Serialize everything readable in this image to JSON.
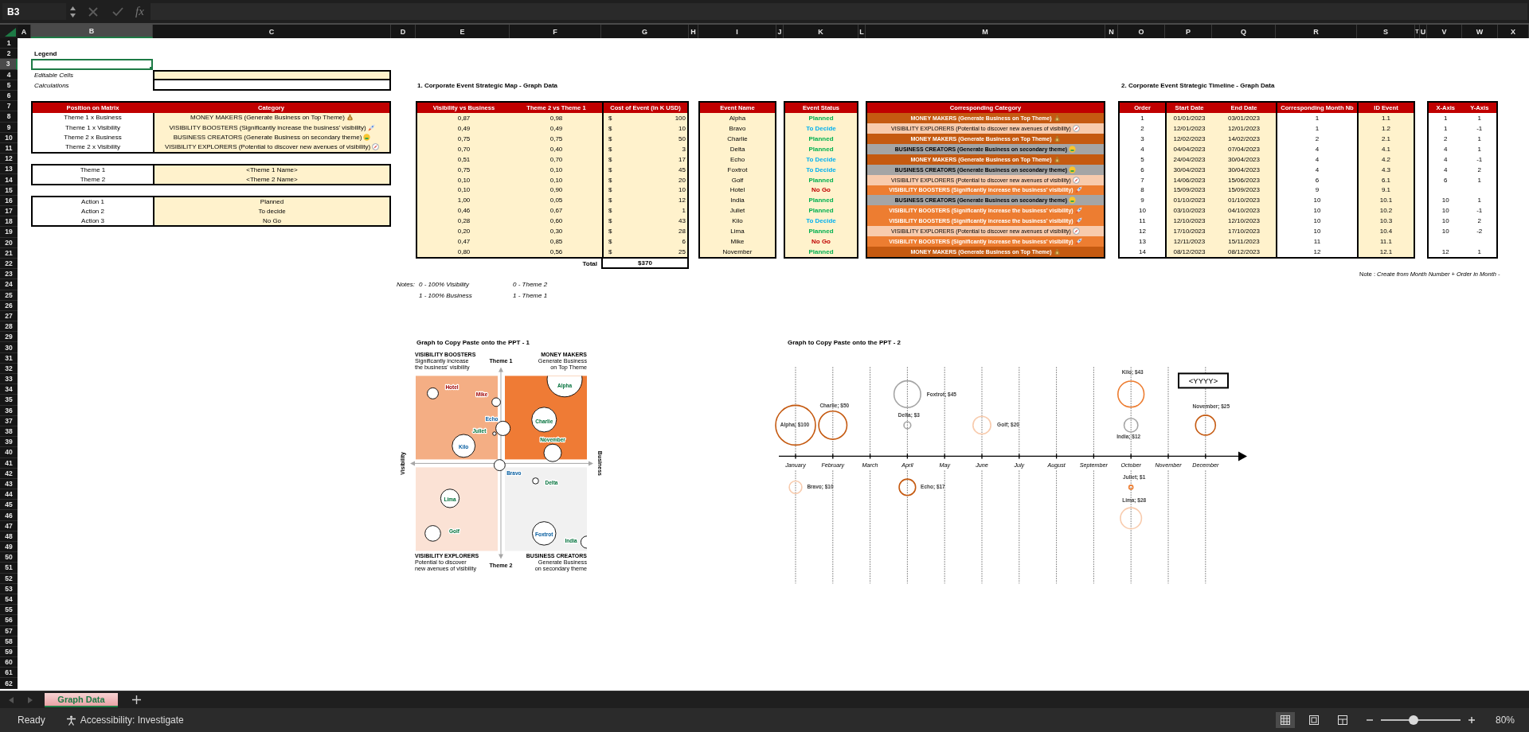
{
  "formula_bar": {
    "name_box": "B3",
    "function_label": "fx"
  },
  "column_headers": [
    {
      "label": "A",
      "selected": false
    },
    {
      "label": "B",
      "selected": true
    },
    {
      "label": "C",
      "selected": false
    },
    {
      "label": "D",
      "selected": false
    },
    {
      "label": "E",
      "selected": false
    },
    {
      "label": "F",
      "selected": false
    },
    {
      "label": "G",
      "selected": false
    },
    {
      "label": "H",
      "selected": false
    },
    {
      "label": "I",
      "selected": false
    },
    {
      "label": "J",
      "selected": false
    },
    {
      "label": "K",
      "selected": false
    },
    {
      "label": "L",
      "selected": false
    },
    {
      "label": "M",
      "selected": false
    },
    {
      "label": "N",
      "selected": false
    },
    {
      "label": "O",
      "selected": false
    },
    {
      "label": "P",
      "selected": false
    },
    {
      "label": "Q",
      "selected": false
    },
    {
      "label": "R",
      "selected": false
    },
    {
      "label": "S",
      "selected": false
    },
    {
      "label": "T",
      "selected": false
    },
    {
      "label": "U",
      "selected": false
    },
    {
      "label": "V",
      "selected": false
    },
    {
      "label": "W",
      "selected": false
    },
    {
      "label": "X",
      "selected": false
    }
  ],
  "row_headers": [
    {
      "label": "1",
      "selected": false
    },
    {
      "label": "2",
      "selected": false
    },
    {
      "label": "3",
      "selected": true
    },
    {
      "label": "4",
      "selected": false
    },
    {
      "label": "5",
      "selected": false
    },
    {
      "label": "6",
      "selected": false
    },
    {
      "label": "7",
      "selected": false
    },
    {
      "label": "8",
      "selected": false
    },
    {
      "label": "9",
      "selected": false
    },
    {
      "label": "10",
      "selected": false
    },
    {
      "label": "11",
      "selected": false
    },
    {
      "label": "12",
      "selected": false
    },
    {
      "label": "13",
      "selected": false
    },
    {
      "label": "14",
      "selected": false
    },
    {
      "label": "15",
      "selected": false
    },
    {
      "label": "16",
      "selected": false
    },
    {
      "label": "17",
      "selected": false
    },
    {
      "label": "18",
      "selected": false
    },
    {
      "label": "19",
      "selected": false
    },
    {
      "label": "20",
      "selected": false
    },
    {
      "label": "21",
      "selected": false
    },
    {
      "label": "22",
      "selected": false
    },
    {
      "label": "23",
      "selected": false
    },
    {
      "label": "24",
      "selected": false
    },
    {
      "label": "25",
      "selected": false
    },
    {
      "label": "26",
      "selected": false
    },
    {
      "label": "27",
      "selected": false
    },
    {
      "label": "28",
      "selected": false
    },
    {
      "label": "29",
      "selected": false
    },
    {
      "label": "30",
      "selected": false
    },
    {
      "label": "31",
      "selected": false
    },
    {
      "label": "32",
      "selected": false
    },
    {
      "label": "33",
      "selected": false
    },
    {
      "label": "34",
      "selected": false
    },
    {
      "label": "35",
      "selected": false
    },
    {
      "label": "36",
      "selected": false
    },
    {
      "label": "37",
      "selected": false
    },
    {
      "label": "38",
      "selected": false
    },
    {
      "label": "39",
      "selected": false
    },
    {
      "label": "40",
      "selected": false
    },
    {
      "label": "41",
      "selected": false
    },
    {
      "label": "42",
      "selected": false
    },
    {
      "label": "43",
      "selected": false
    },
    {
      "label": "44",
      "selected": false
    },
    {
      "label": "45",
      "selected": false
    },
    {
      "label": "46",
      "selected": false
    },
    {
      "label": "47",
      "selected": false
    },
    {
      "label": "48",
      "selected": false
    },
    {
      "label": "49",
      "selected": false
    },
    {
      "label": "50",
      "selected": false
    },
    {
      "label": "51",
      "selected": false
    },
    {
      "label": "52",
      "selected": false
    },
    {
      "label": "53",
      "selected": false
    },
    {
      "label": "54",
      "selected": false
    },
    {
      "label": "55",
      "selected": false
    },
    {
      "label": "56",
      "selected": false
    },
    {
      "label": "57",
      "selected": false
    },
    {
      "label": "58",
      "selected": false
    },
    {
      "label": "59",
      "selected": false
    },
    {
      "label": "60",
      "selected": false
    },
    {
      "label": "61",
      "selected": false
    },
    {
      "label": "62",
      "selected": false
    }
  ],
  "legend": {
    "title": "Legend",
    "items": [
      {
        "label": "Editable Cells",
        "kind": "editable"
      },
      {
        "label": "Calculations",
        "kind": "calculation"
      }
    ]
  },
  "position_table": {
    "columns": [
      "Position on Matrix",
      "Category"
    ],
    "rows": [
      {
        "position": "Theme 1 x Business",
        "category": "MONEY MAKERS (Generate Business on Top Theme)",
        "kind": "money_makers"
      },
      {
        "position": "Theme 1 x Visibility",
        "category": "VISIBILITY BOOSTERS (Significantly increase the business’ visibility)",
        "kind": "visibility_boosters"
      },
      {
        "position": "Theme 2 x Business",
        "category": "BUSINESS CREATORS (Generate Business on secondary theme)",
        "kind": "business_creators"
      },
      {
        "position": "Theme 2 x Visibility",
        "category": "VISIBILITY EXPLORERS (Potential to discover new avenues of visibility)",
        "kind": "visibility_explorers"
      }
    ]
  },
  "themes": [
    {
      "label": "Theme 1",
      "value": "<Theme 1 Name>"
    },
    {
      "label": "Theme 2",
      "value": "<Theme 2 Name>"
    }
  ],
  "actions": [
    {
      "label": "Action 1",
      "value": "Planned"
    },
    {
      "label": "Action 2",
      "value": "To decide"
    },
    {
      "label": "Action 3",
      "value": "No Go"
    }
  ],
  "section_1_title": "1. Corporate Event Strategic Map - Graph Data",
  "map_table": {
    "columns": [
      "Visibility vs Business",
      "Theme 2 vs Theme 1",
      "Cost of Event (in K USD)"
    ],
    "total_label": "Total",
    "total": "$370",
    "rows": [
      {
        "visibility": "0,87",
        "theme": "0,98",
        "currency": "$",
        "cost": "100"
      },
      {
        "visibility": "0,49",
        "theme": "0,49",
        "currency": "$",
        "cost": "10"
      },
      {
        "visibility": "0,75",
        "theme": "0,75",
        "currency": "$",
        "cost": "50"
      },
      {
        "visibility": "0,70",
        "theme": "0,40",
        "currency": "$",
        "cost": "3"
      },
      {
        "visibility": "0,51",
        "theme": "0,70",
        "currency": "$",
        "cost": "17"
      },
      {
        "visibility": "0,75",
        "theme": "0,10",
        "currency": "$",
        "cost": "45"
      },
      {
        "visibility": "0,10",
        "theme": "0,10",
        "currency": "$",
        "cost": "20"
      },
      {
        "visibility": "0,10",
        "theme": "0,90",
        "currency": "$",
        "cost": "10"
      },
      {
        "visibility": "1,00",
        "theme": "0,05",
        "currency": "$",
        "cost": "12"
      },
      {
        "visibility": "0,46",
        "theme": "0,67",
        "currency": "$",
        "cost": "1"
      },
      {
        "visibility": "0,28",
        "theme": "0,60",
        "currency": "$",
        "cost": "43"
      },
      {
        "visibility": "0,20",
        "theme": "0,30",
        "currency": "$",
        "cost": "28"
      },
      {
        "visibility": "0,47",
        "theme": "0,85",
        "currency": "$",
        "cost": "6"
      },
      {
        "visibility": "0,80",
        "theme": "0,56",
        "currency": "$",
        "cost": "25"
      }
    ]
  },
  "events": {
    "column": "Event Name",
    "rows": [
      "Alpha",
      "Bravo",
      "Charlie",
      "Delta",
      "Echo",
      "Foxtrot",
      "Golf",
      "Hotel",
      "India",
      "Juliet",
      "Kilo",
      "Lima",
      "Mike",
      "November"
    ]
  },
  "statuses": {
    "column": "Event Status",
    "rows": [
      {
        "label": "Planned",
        "kind": "planned"
      },
      {
        "label": "To Decide",
        "kind": "to_decide"
      },
      {
        "label": "Planned",
        "kind": "planned"
      },
      {
        "label": "Planned",
        "kind": "planned"
      },
      {
        "label": "To Decide",
        "kind": "to_decide"
      },
      {
        "label": "To Decide",
        "kind": "to_decide"
      },
      {
        "label": "Planned",
        "kind": "planned"
      },
      {
        "label": "No Go",
        "kind": "no_go"
      },
      {
        "label": "Planned",
        "kind": "planned"
      },
      {
        "label": "Planned",
        "kind": "planned"
      },
      {
        "label": "To Decide",
        "kind": "to_decide"
      },
      {
        "label": "Planned",
        "kind": "planned"
      },
      {
        "label": "No Go",
        "kind": "no_go"
      },
      {
        "label": "Planned",
        "kind": "planned"
      }
    ]
  },
  "categories": {
    "column": "Corresponding Category",
    "rows": [
      {
        "label": "MONEY MAKERS (Generate Business on Top Theme)",
        "kind": "money_makers"
      },
      {
        "label": "VISIBILITY EXPLORERS (Potential to discover new avenues of visibility)",
        "kind": "visibility_explorers"
      },
      {
        "label": "MONEY MAKERS (Generate Business on Top Theme)",
        "kind": "money_makers"
      },
      {
        "label": "BUSINESS CREATORS (Generate Business on secondary theme)",
        "kind": "business_creators"
      },
      {
        "label": "MONEY MAKERS (Generate Business on Top Theme)",
        "kind": "money_makers"
      },
      {
        "label": "BUSINESS CREATORS (Generate Business on secondary theme)",
        "kind": "business_creators"
      },
      {
        "label": "VISIBILITY EXPLORERS (Potential to discover new avenues of visibility)",
        "kind": "visibility_explorers"
      },
      {
        "label": "VISIBILITY BOOSTERS (Significantly increase the business’ visibility)",
        "kind": "visibility_boosters"
      },
      {
        "label": "BUSINESS CREATORS (Generate Business on secondary theme)",
        "kind": "business_creators"
      },
      {
        "label": "VISIBILITY BOOSTERS (Significantly increase the business’ visibility)",
        "kind": "visibility_boosters"
      },
      {
        "label": "VISIBILITY BOOSTERS (Significantly increase the business’ visibility)",
        "kind": "visibility_boosters"
      },
      {
        "label": "VISIBILITY EXPLORERS (Potential to discover new avenues of visibility)",
        "kind": "visibility_explorers"
      },
      {
        "label": "VISIBILITY BOOSTERS (Significantly increase the business’ visibility)",
        "kind": "visibility_boosters"
      },
      {
        "label": "MONEY MAKERS (Generate Business on Top Theme)",
        "kind": "money_makers"
      }
    ]
  },
  "notes": {
    "label": "Notes:",
    "visibility_axis": [
      "0 - 100% Visibility",
      "1 - 100% Business"
    ],
    "theme_axis": [
      "0 - Theme 2",
      "1 - Theme 1"
    ]
  },
  "section_2_title": "2. Corporate Event Strategic Timeline - Graph Data",
  "timeline_table": {
    "columns": [
      "Order",
      "Start Date",
      "End Date",
      "Corresponding Month Nb",
      "ID Event"
    ],
    "axis_columns": [
      "X-Axis",
      "Y-Axis"
    ],
    "rows": [
      {
        "order": "1",
        "start": "01/01/2023",
        "end": "03/01/2023",
        "month": "1",
        "id": "1.1",
        "x_axis": "1",
        "y_axis": "1"
      },
      {
        "order": "2",
        "start": "12/01/2023",
        "end": "12/01/2023",
        "month": "1",
        "id": "1.2",
        "x_axis": "1",
        "y_axis": "-1"
      },
      {
        "order": "3",
        "start": "12/02/2023",
        "end": "14/02/2023",
        "month": "2",
        "id": "2.1",
        "x_axis": "2",
        "y_axis": "1"
      },
      {
        "order": "4",
        "start": "04/04/2023",
        "end": "07/04/2023",
        "month": "4",
        "id": "4.1",
        "x_axis": "4",
        "y_axis": "1"
      },
      {
        "order": "5",
        "start": "24/04/2023",
        "end": "30/04/2023",
        "month": "4",
        "id": "4.2",
        "x_axis": "4",
        "y_axis": "-1"
      },
      {
        "order": "6",
        "start": "30/04/2023",
        "end": "30/04/2023",
        "month": "4",
        "id": "4.3",
        "x_axis": "4",
        "y_axis": "2"
      },
      {
        "order": "7",
        "start": "14/06/2023",
        "end": "15/06/2023",
        "month": "6",
        "id": "6.1",
        "x_axis": "6",
        "y_axis": "1"
      },
      {
        "order": "8",
        "start": "15/09/2023",
        "end": "15/09/2023",
        "month": "9",
        "id": "9.1"
      },
      {
        "order": "9",
        "start": "01/10/2023",
        "end": "01/10/2023",
        "month": "10",
        "id": "10.1",
        "x_axis": "10",
        "y_axis": "1"
      },
      {
        "order": "10",
        "start": "03/10/2023",
        "end": "04/10/2023",
        "month": "10",
        "id": "10.2",
        "x_axis": "10",
        "y_axis": "-1"
      },
      {
        "order": "11",
        "start": "12/10/2023",
        "end": "12/10/2023",
        "month": "10",
        "id": "10.3",
        "x_axis": "10",
        "y_axis": "2"
      },
      {
        "order": "12",
        "start": "17/10/2023",
        "end": "17/10/2023",
        "month": "10",
        "id": "10.4",
        "x_axis": "10",
        "y_axis": "-2"
      },
      {
        "order": "13",
        "start": "12/11/2023",
        "end": "15/11/2023",
        "month": "11",
        "id": "11.1"
      },
      {
        "order": "14",
        "start": "08/12/2023",
        "end": "08/12/2023",
        "month": "12",
        "id": "12.1",
        "x_axis": "12",
        "y_axis": "1"
      }
    ]
  },
  "timeline_note": "Note : *Create from Month Number + Order in Month -*",
  "chart_1": {
    "title": "Graph to Copy Paste onto the PPT - 1",
    "quadrants": [
      {
        "title": "VISIBILITY BOOSTERS",
        "subtitle": "Significantly increase the business' visibility",
        "kind": "visibility_boosters"
      },
      {
        "title": "MONEY MAKERS",
        "subtitle": "Generate Business on Top Theme",
        "kind": "money_makers"
      },
      {
        "title": "VISIBILITY EXPLORERS",
        "subtitle": "Potential to discover new avenues of visibility",
        "kind": "visibility_explorers"
      },
      {
        "title": "BUSINESS CREATORS",
        "subtitle": "Generate Business on secondary theme",
        "kind": "business_creators"
      }
    ],
    "axis_top": "Theme 1",
    "axis_bottom": "Theme 2",
    "axis_left": "Visibility",
    "axis_right": "Business",
    "point_labels": [
      "Alpha",
      "Bravo",
      "Charlie",
      "Delta",
      "Echo",
      "Foxtrot",
      "Golf",
      "Hotel",
      "India",
      "Juliet",
      "Kilo",
      "Lima",
      "Mike",
      "November"
    ]
  },
  "chart_2": {
    "title": "Graph to Copy Paste onto the PPT - 2",
    "year_label": "<YYYY>",
    "months": [
      "January",
      "February",
      "March",
      "April",
      "May",
      "June",
      "July",
      "August",
      "September",
      "October",
      "November",
      "December"
    ],
    "point_labels": [
      "Alpha; $100",
      "Bravo; $10",
      "Charlie; $50",
      "Foxtrot; $45",
      "Delta; $3",
      "Echo; $17",
      "Golf; $20",
      "Kilo; $43",
      "India; $12",
      "Juliet; $1",
      "Lima; $28",
      "November; $25"
    ]
  },
  "sheet_tabs": [
    {
      "label": "Graph Data",
      "selected": true
    }
  ],
  "status_bar": {
    "mode": "Ready",
    "accessibility": "Accessibility: Investigate",
    "zoom": "80%",
    "zoom_level": {
      "level": 0.41
    },
    "views": [
      {
        "kind": "normal",
        "selected": true
      },
      {
        "kind": "page_layout",
        "selected": false
      },
      {
        "kind": "page_break",
        "selected": false
      }
    ]
  }
}
